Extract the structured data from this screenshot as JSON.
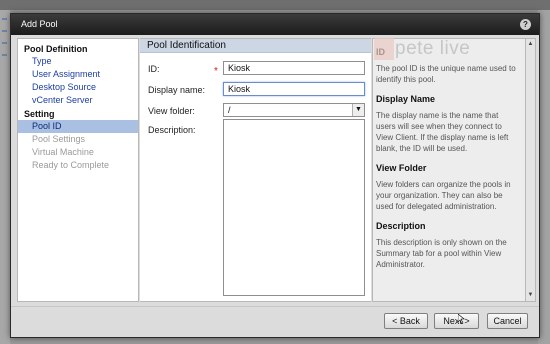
{
  "dialog": {
    "title": "Add Pool",
    "help_glyph": "?"
  },
  "nav": {
    "sections": [
      {
        "heading": "Pool Definition",
        "items": [
          {
            "label": "Type"
          },
          {
            "label": "User Assignment"
          },
          {
            "label": "Desktop Source"
          },
          {
            "label": "vCenter Server"
          }
        ]
      },
      {
        "heading": "Setting",
        "items": [
          {
            "label": "Pool ID",
            "active": true
          },
          {
            "label": "Pool Settings",
            "disabled": true
          },
          {
            "label": "Virtual Machine",
            "disabled": true
          },
          {
            "label": "Ready to Complete",
            "disabled": true
          }
        ]
      }
    ]
  },
  "main": {
    "title": "Pool Identification",
    "id_label": "ID:",
    "id_value": "Kiosk",
    "display_label": "Display name:",
    "display_value": "Kiosk",
    "folder_label": "View folder:",
    "folder_value": "/",
    "description_label": "Description:",
    "required_marker": "*"
  },
  "help": [
    {
      "heading": "ID",
      "text": "The pool ID is the unique name used to identify this pool."
    },
    {
      "heading": "Display Name",
      "text": "The display name is the name that users will see when they connect to View Client. If the display name is left blank, the ID will be used."
    },
    {
      "heading": "View Folder",
      "text": "View folders can organize the pools in your organization. They can also be used for delegated administration."
    },
    {
      "heading": "Description",
      "text": "This description is only shown on the Summary tab for a pool within View Administrator."
    }
  ],
  "watermark": "pete     live",
  "footer": {
    "back_label": "< Back",
    "next_label": "Next >",
    "cancel_label": "Cancel"
  },
  "icons": {
    "dropdown": "chevron-down-icon",
    "help": "help-icon",
    "cursor": "mouse-pointer-icon"
  },
  "colors": {
    "titlebar": "#1c1c1c",
    "nav_active": "#a9c0e2",
    "link": "#1d3fa3",
    "section_header": "#cdd6e3"
  }
}
